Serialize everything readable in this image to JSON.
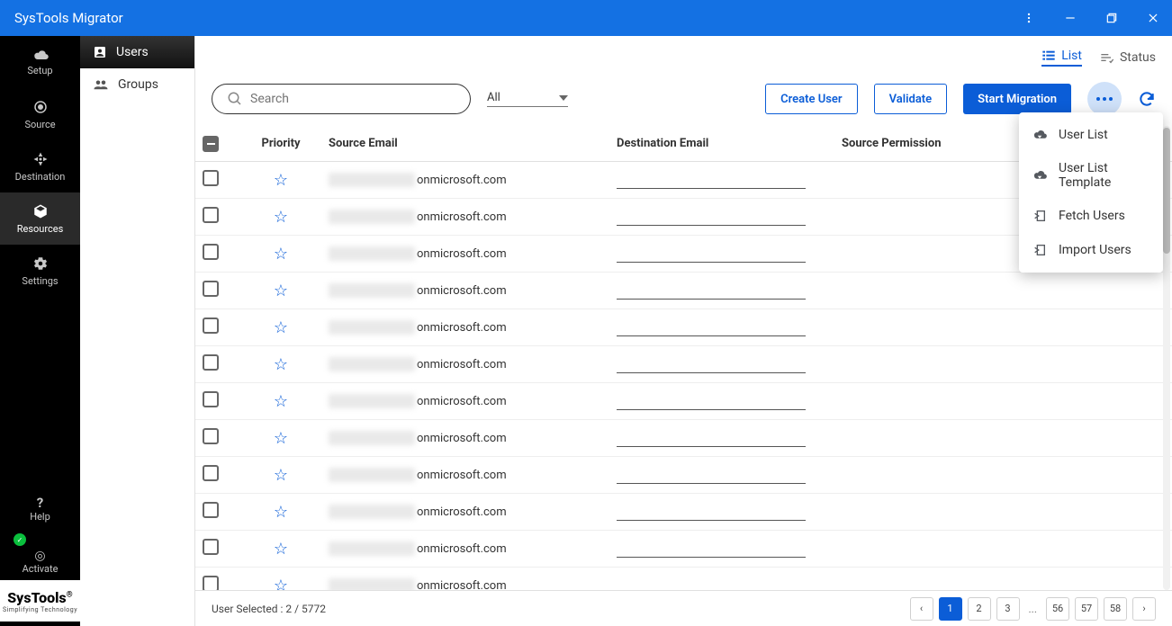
{
  "window": {
    "title": "SysTools Migrator"
  },
  "sidebar": {
    "items": [
      {
        "label": "Setup",
        "icon": "cloud"
      },
      {
        "label": "Source",
        "icon": "target"
      },
      {
        "label": "Destination",
        "icon": "target"
      },
      {
        "label": "Resources",
        "icon": "cube",
        "active": true
      },
      {
        "label": "Settings",
        "icon": "gear"
      }
    ],
    "bottom": {
      "help": "Help",
      "activate": "Activate"
    },
    "brand": {
      "main": "SysTools",
      "sub": "Simplifying Technology"
    }
  },
  "subpanel": {
    "users": {
      "label": "Users",
      "active": true
    },
    "groups": {
      "label": "Groups"
    }
  },
  "views": {
    "list": "List",
    "status": "Status"
  },
  "toolbar": {
    "search_placeholder": "Search",
    "filter": "All",
    "create_user": "Create User",
    "validate": "Validate",
    "start_migration": "Start Migration"
  },
  "table": {
    "headers": {
      "priority": "Priority",
      "source_email": "Source Email",
      "destination_email": "Destination Email",
      "source_permission": "Source Permission"
    },
    "domain_suffix": "onmicrosoft.com",
    "row_count": 12
  },
  "dropdown": {
    "user_list": "User List",
    "user_list_template": "User List Template",
    "fetch_users": "Fetch Users",
    "import_users": "Import Users"
  },
  "footer": {
    "selected": "User Selected : 2 / 5772"
  },
  "pagination": {
    "pages_front": [
      "1",
      "2",
      "3"
    ],
    "ellipsis": "...",
    "pages_back": [
      "56",
      "57",
      "58"
    ]
  }
}
